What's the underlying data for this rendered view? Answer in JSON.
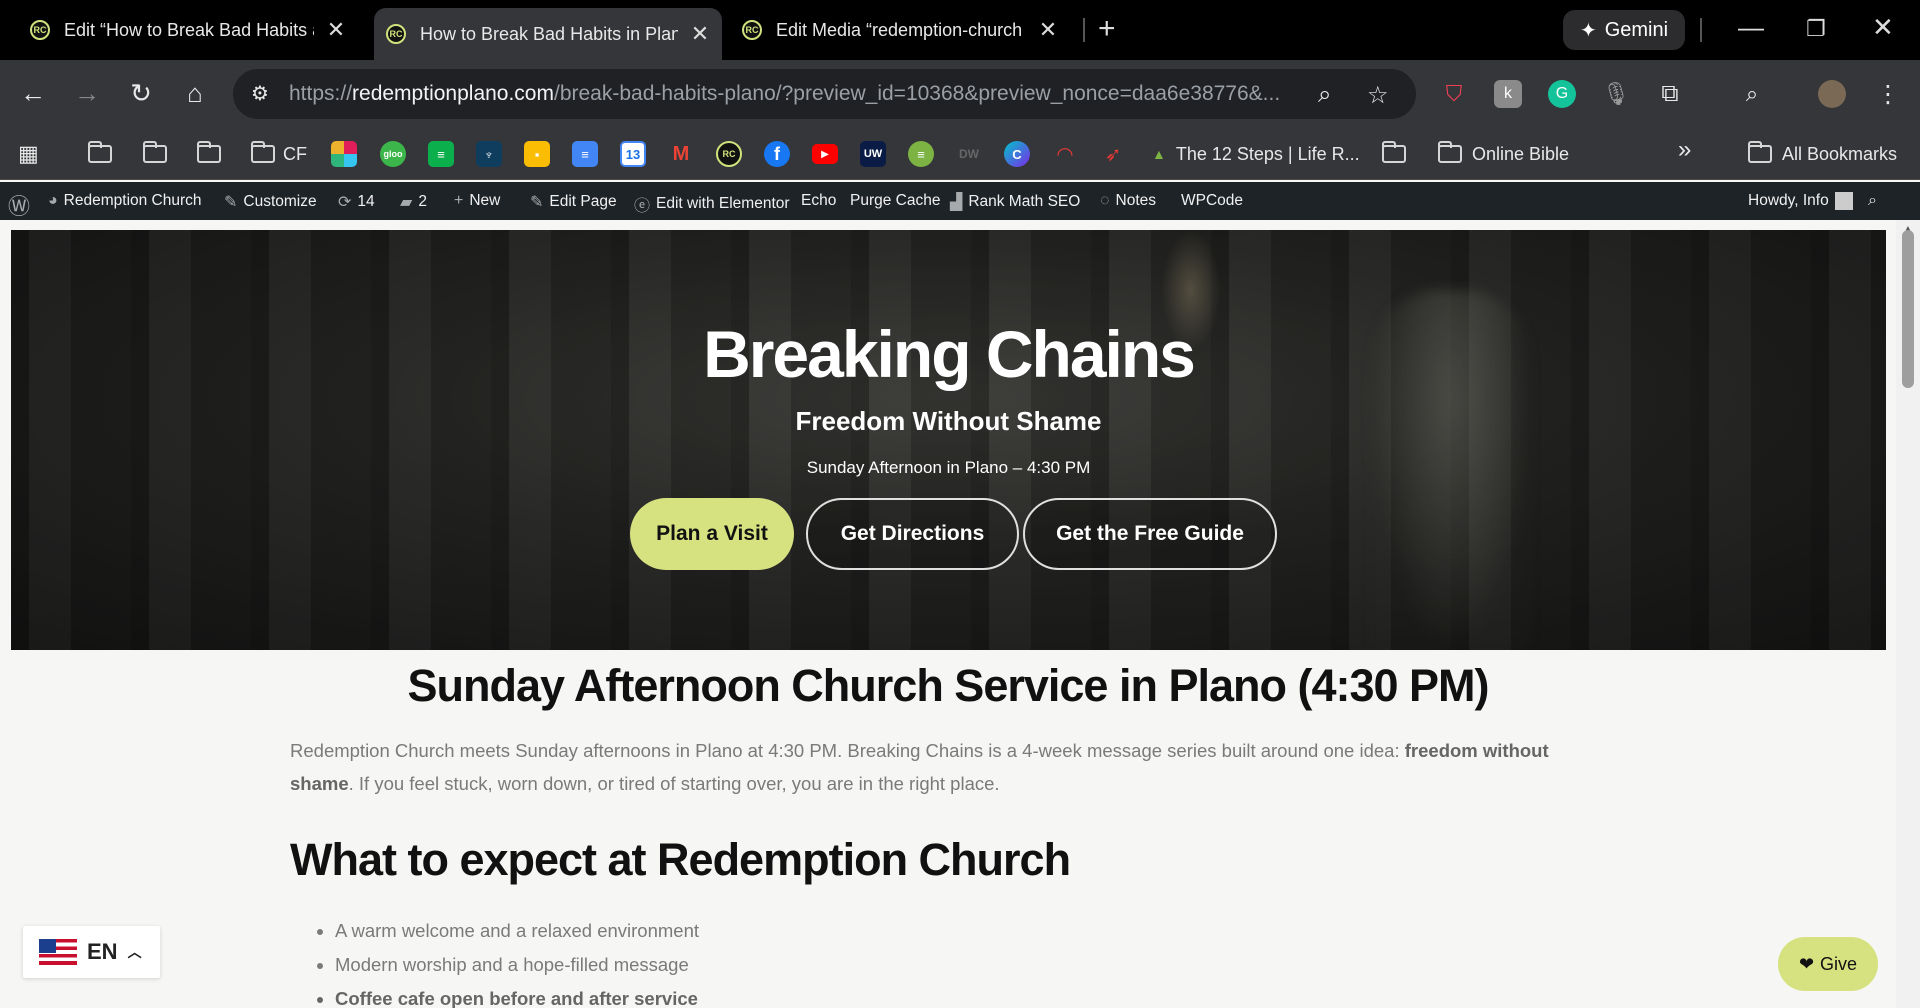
{
  "browser": {
    "tabs": [
      {
        "title": "Edit “How to Break Bad Habits a",
        "favicon": "RC"
      },
      {
        "title": "How to Break Bad Habits in Plan",
        "favicon": "RC"
      },
      {
        "title": "Edit Media “redemption-church",
        "favicon": "RC"
      }
    ],
    "new_tab_label": "+",
    "gemini_label": "Gemini",
    "url_scheme": "https://",
    "url_host": "redemptionplano.com",
    "url_path": "/break-bad-habits-plano/?preview_id=10368&preview_nonce=daa6e38776&..."
  },
  "bookmarks": {
    "items": [
      {
        "label": "CF"
      },
      {
        "label": "The 12 Steps | Life R..."
      },
      {
        "label": "Online Bible"
      },
      {
        "label": "All Bookmarks"
      }
    ],
    "overflow_label": "»"
  },
  "adminbar": {
    "site": "Redemption Church",
    "customize": "Customize",
    "updates": "14",
    "comments": "2",
    "new": "New",
    "edit_page": "Edit Page",
    "elementor": "Edit with Elementor",
    "echo": "Echo",
    "purge": "Purge Cache",
    "rankmath": "Rank Math SEO",
    "notes": "Notes",
    "wpcode": "WPCode",
    "howdy": "Howdy, Info"
  },
  "hero": {
    "title": "Breaking Chains",
    "subtitle": "Freedom Without Shame",
    "meta": "Sunday Afternoon in Plano – 4:30 PM",
    "buttons": [
      "Plan a Visit",
      "Get Directions",
      "Get the Free Guide"
    ]
  },
  "content": {
    "heading": "Sunday Afternoon Church Service in Plano (4:30 PM)",
    "para_1": "Redemption Church meets Sunday afternoons in Plano at 4:30 PM. Breaking Chains is a 4-week message series built around one idea: ",
    "para_bold": "freedom without shame",
    "para_2": ". If you feel stuck, worn down, or tired of starting over, you are in the right place.",
    "subheading": "What to expect at Redemption Church",
    "list": [
      "A warm welcome and a relaxed environment",
      "Modern worship and a hope-filled message",
      "Coffee cafe open before and after service"
    ]
  },
  "widgets": {
    "language": "EN",
    "give": "Give"
  },
  "colors": {
    "accent": "#d6e27f",
    "adminbar": "#1d2327",
    "chrome": "#35363a"
  }
}
